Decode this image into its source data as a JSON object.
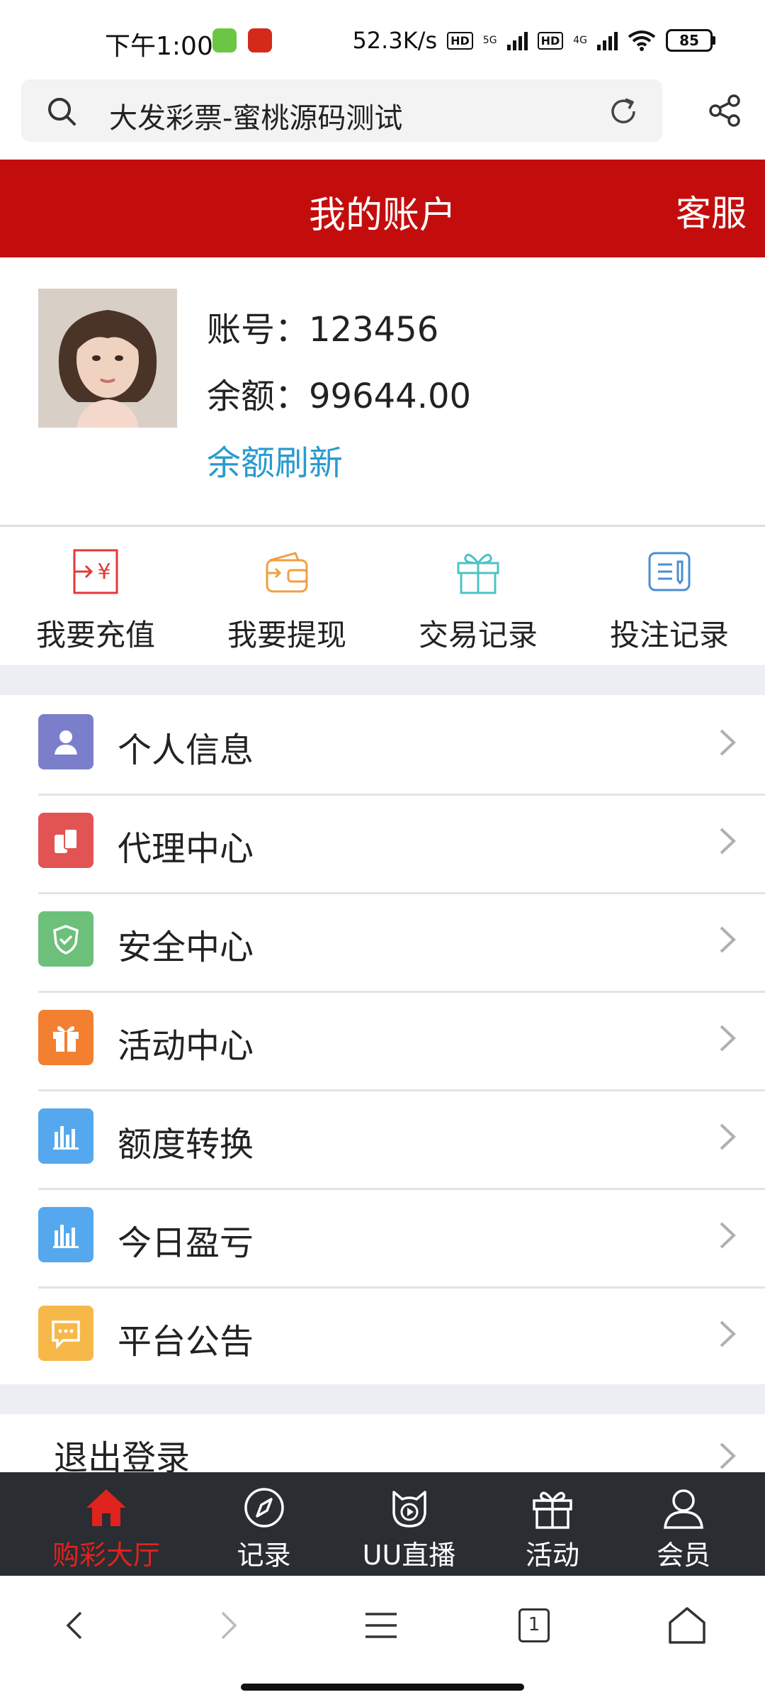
{
  "status_bar": {
    "time": "下午1:00",
    "net_speed": "52.3K/s",
    "hd1": "HD",
    "net1": "5G",
    "hd2": "HD",
    "net2": "4G",
    "battery": "85"
  },
  "browser": {
    "url_text": "大发彩票-蜜桃源码测试"
  },
  "header": {
    "title": "我的账户",
    "service": "客服"
  },
  "profile": {
    "account_line": "账号：123456",
    "balance_line": "余额：99644.00",
    "refresh": "余额刷新"
  },
  "quick_actions": [
    {
      "label": "我要充值",
      "icon": "recharge-icon",
      "color": "#e23a3a"
    },
    {
      "label": "我要提现",
      "icon": "wallet-icon",
      "color": "#f0a040"
    },
    {
      "label": "交易记录",
      "icon": "gift-icon",
      "color": "#4cc3c3"
    },
    {
      "label": "投注记录",
      "icon": "document-icon",
      "color": "#4a8fd0"
    }
  ],
  "menu": {
    "items": [
      {
        "label": "个人信息",
        "icon": "user-icon",
        "color": "#7b7fcb"
      },
      {
        "label": "代理中心",
        "icon": "coins-icon",
        "color": "#e25454"
      },
      {
        "label": "安全中心",
        "icon": "shield-icon",
        "color": "#6cc07a"
      },
      {
        "label": "活动中心",
        "icon": "gift-icon",
        "color": "#f28030"
      },
      {
        "label": "额度转换",
        "icon": "bar-chart-icon",
        "color": "#55a8ee"
      },
      {
        "label": "今日盈亏",
        "icon": "bar-chart-icon",
        "color": "#55a8ee"
      },
      {
        "label": "平台公告",
        "icon": "message-icon",
        "color": "#f7b84a"
      }
    ],
    "logout": "退出登录"
  },
  "bottom_nav": [
    {
      "label": "购彩大厅",
      "icon": "home-icon",
      "active": true
    },
    {
      "label": "记录",
      "icon": "compass-icon",
      "active": false
    },
    {
      "label": "UU直播",
      "icon": "live-play-icon",
      "active": false
    },
    {
      "label": "活动",
      "icon": "gift-icon",
      "active": false
    },
    {
      "label": "会员",
      "icon": "user-icon",
      "active": false
    }
  ],
  "browser_nav": {
    "tab_count": "1"
  },
  "colors": {
    "header_red": "#c30d0d",
    "link_blue": "#2a9ad0",
    "nav_active": "#e0231c",
    "nav_bg": "#2a2d32"
  }
}
